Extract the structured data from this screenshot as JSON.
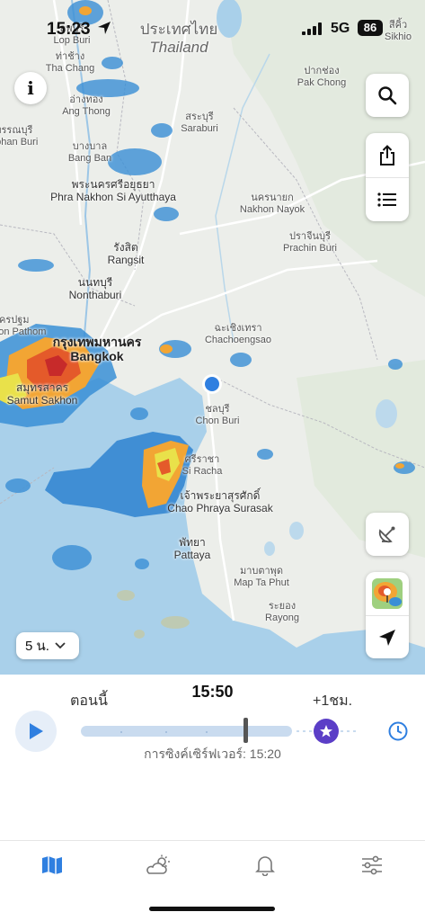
{
  "status_bar": {
    "time": "15:23",
    "network": "5G",
    "battery": "86"
  },
  "map": {
    "country_th": "ประเทศไทย",
    "country_en": "Thailand",
    "corner_label_th": "สีคิ้ว",
    "corner_label_en": "Sikhio",
    "places": [
      {
        "th": "ลพบุรี",
        "en": "Lop Buri"
      },
      {
        "th": "ท่าช้าง",
        "en": "Tha Chang"
      },
      {
        "th": "อ่างทอง",
        "en": "Ang Thong"
      },
      {
        "th": "สุพรรณบุรี",
        "en": "Suphan Buri"
      },
      {
        "th": "บางบาล",
        "en": "Bang Ban"
      },
      {
        "th": "สระบุรี",
        "en": "Saraburi"
      },
      {
        "th": "ปากช่อง",
        "en": "Pak Chong"
      },
      {
        "th": "พระนครศรีอยุธยา",
        "en": "Phra Nakhon Si Ayutthaya"
      },
      {
        "th": "นครนายก",
        "en": "Nakhon Nayok"
      },
      {
        "th": "ปราจีนบุรี",
        "en": "Prachin Buri"
      },
      {
        "th": "รังสิต",
        "en": "Rangsit"
      },
      {
        "th": "นนทบุรี",
        "en": "Nonthaburi"
      },
      {
        "th": "นครปฐม",
        "en": "Nakhon Pathom"
      },
      {
        "th": "กรุงเทพมหานคร",
        "en": "Bangkok"
      },
      {
        "th": "สมุทรสาคร",
        "en": "Samut Sakhon"
      },
      {
        "th": "ฉะเชิงเทรา",
        "en": "Chachoengsao"
      },
      {
        "th": "ชลบุรี",
        "en": "Chon Buri"
      },
      {
        "th": "ศรีราชา",
        "en": "Si Racha"
      },
      {
        "th": "เจ้าพระยาสุรศักดิ์",
        "en": "Chao Phraya Surasak"
      },
      {
        "th": "พัทยา",
        "en": "Pattaya"
      },
      {
        "th": "มาบตาพุด",
        "en": "Map Ta Phut"
      },
      {
        "th": "ระยอง",
        "en": "Rayong"
      }
    ],
    "duration_label": "5 น."
  },
  "timeline": {
    "now_label": "ตอนนี้",
    "current_time": "15:50",
    "plus_label": "+1ชม.",
    "progress": 0.78,
    "sync_text": "การซิงค์เซิร์ฟเวอร์: 15:20"
  },
  "tabs": [
    "map-icon",
    "weather-icon",
    "bell-icon",
    "settings-sliders-icon"
  ],
  "colors": {
    "accent": "#2f7fe0",
    "star": "#5b3ec7",
    "track": "#c9dbef"
  }
}
